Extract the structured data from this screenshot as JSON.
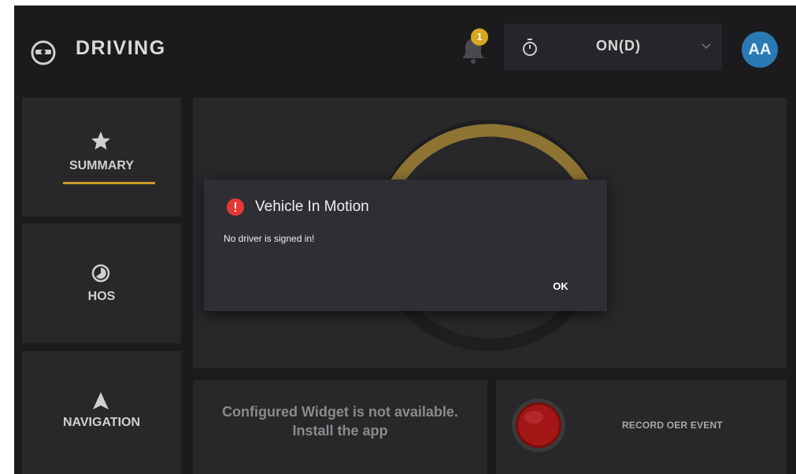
{
  "header": {
    "title": "DRIVING",
    "notifications_count": "1",
    "duty_status": "ON(D)",
    "avatar_initials": "AA"
  },
  "sidebar": {
    "items": [
      {
        "label": "SUMMARY",
        "icon": "star-icon",
        "active": true
      },
      {
        "label": "HOS",
        "icon": "clock-icon",
        "active": false
      },
      {
        "label": "NAVIGATION",
        "icon": "navigation-arrow-icon",
        "active": false
      }
    ]
  },
  "widget": {
    "line1": "Configured Widget is not available.",
    "line2": "Install the app"
  },
  "record": {
    "label": "RECORD OER EVENT"
  },
  "dialog": {
    "title": "Vehicle In Motion",
    "message": "No driver is signed in!",
    "ok_label": "OK"
  },
  "colors": {
    "accent": "#c89b28",
    "badge": "#d6a521",
    "avatar": "#2a79b5",
    "alert": "#e53935",
    "record": "#a31616"
  }
}
